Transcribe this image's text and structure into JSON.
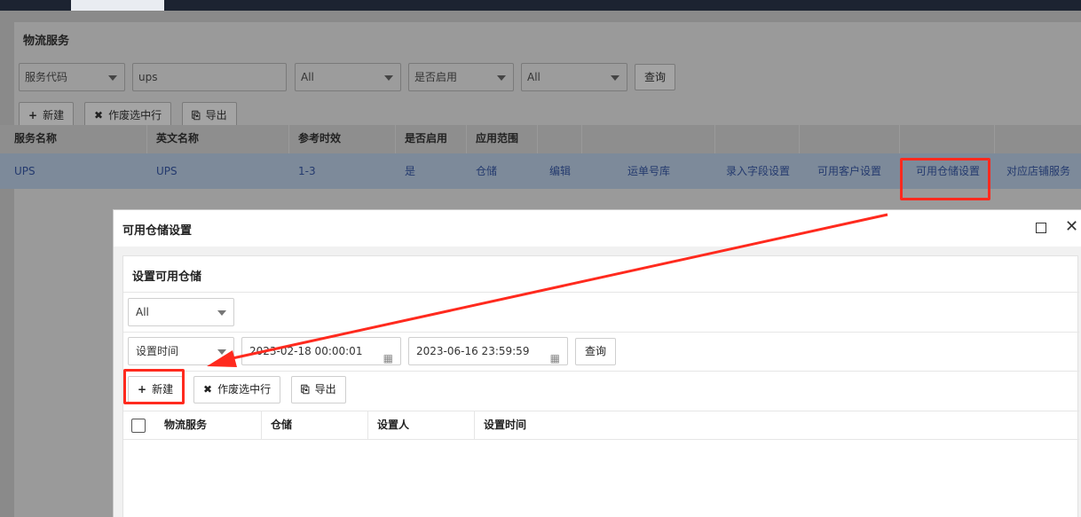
{
  "page": {
    "panel_title": "物流服务",
    "filters": {
      "field_select": "服务代码",
      "search_value": "ups",
      "select_all_1": "All",
      "enable_select": "是否启用",
      "select_all_2": "All",
      "query_button": "查询"
    },
    "toolbar": {
      "new_label": "新建",
      "void_label": "作废选中行",
      "export_label": "导出"
    },
    "table": {
      "headers": [
        "服务名称",
        "英文名称",
        "参考时效",
        "是否启用",
        "应用范围"
      ],
      "row": {
        "name": "UPS",
        "english_name": "UPS",
        "time": "1-3",
        "enabled": "是",
        "scope": "仓储",
        "actions": [
          "编辑",
          "运单号库",
          "录入字段设置",
          "可用客户设置",
          "可用仓储设置",
          "对应店铺服务"
        ]
      }
    }
  },
  "modal": {
    "title": "可用仓储设置",
    "section_title": "设置可用仓储",
    "filter_select": "All",
    "time_select": "设置时间",
    "date_from": "2023-02-18 00:00:01",
    "date_to": "2023-06-16 23:59:59",
    "query_button": "查询",
    "toolbar": {
      "new_label": "新建",
      "void_label": "作废选中行",
      "export_label": "导出"
    },
    "table_headers": [
      "物流服务",
      "仓储",
      "设置人",
      "设置时间"
    ]
  },
  "annotation": {
    "highlight_color": "#ff2a1e"
  }
}
